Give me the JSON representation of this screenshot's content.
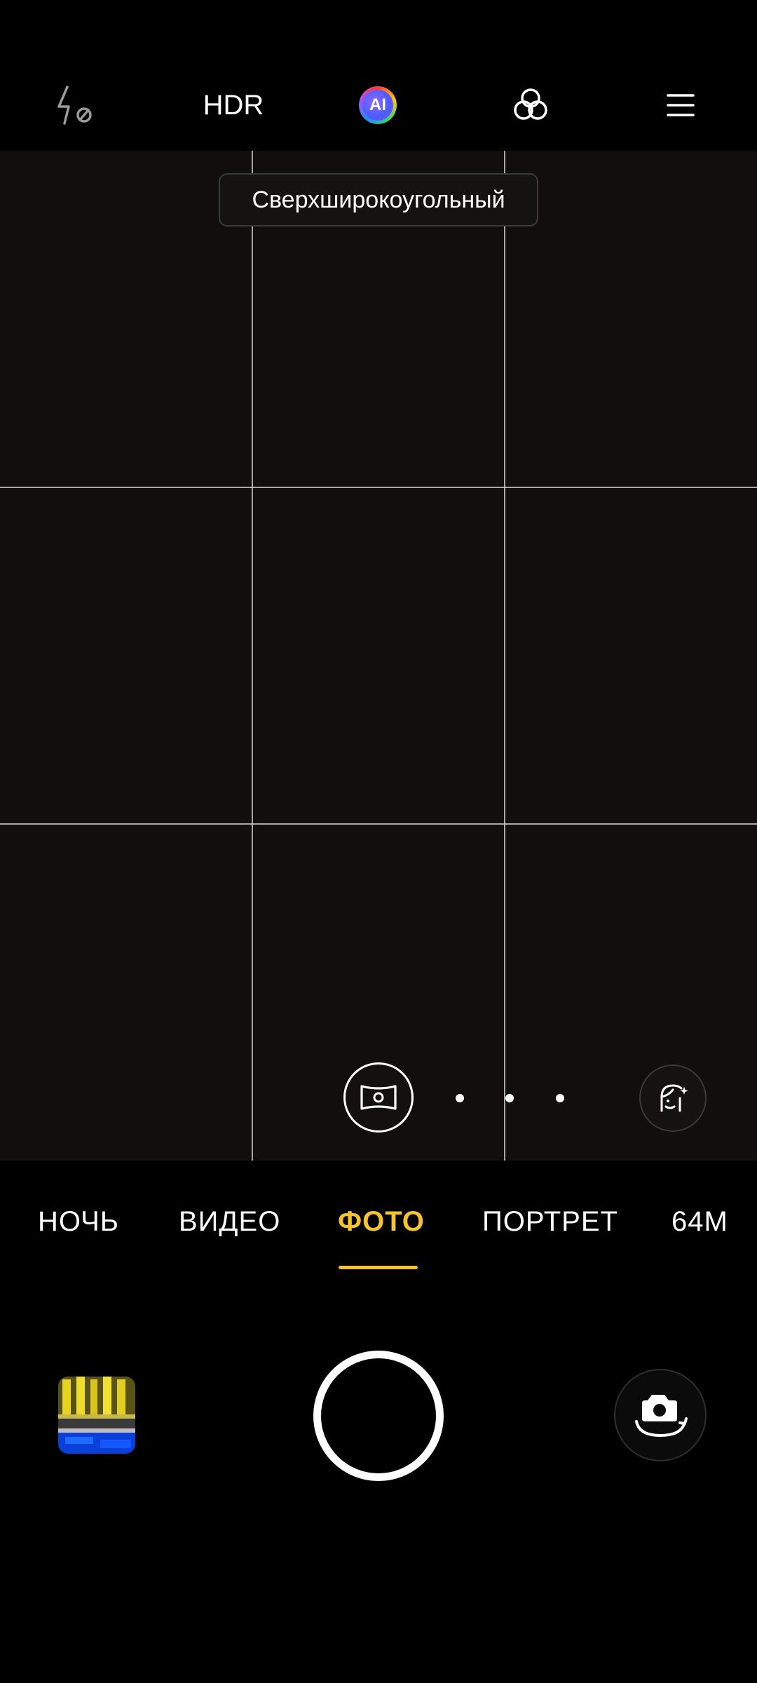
{
  "top_bar": {
    "flash_icon": "flash-off-icon",
    "hdr_label": "HDR",
    "ai_label": "AI",
    "filter_icon": "filters-icon",
    "menu_icon": "menu-icon"
  },
  "viewfinder": {
    "lens_label": "Сверхширокоугольный",
    "panorama_icon": "panorama-icon",
    "beauty_icon": "beauty-face-icon",
    "grid_lines": "on"
  },
  "modes": {
    "items": [
      "НОЧЬ",
      "ВИДЕО",
      "ФОТО",
      "ПОРТРЕТ",
      "64M"
    ],
    "selected": "ФОТО"
  },
  "controls": {
    "gallery_icon": "gallery-thumbnail",
    "shutter_icon": "shutter-button",
    "switch_icon": "switch-camera-icon"
  },
  "colors": {
    "accent": "#f6c22d",
    "background": "#000000",
    "viewfinder": "#120e0e"
  }
}
